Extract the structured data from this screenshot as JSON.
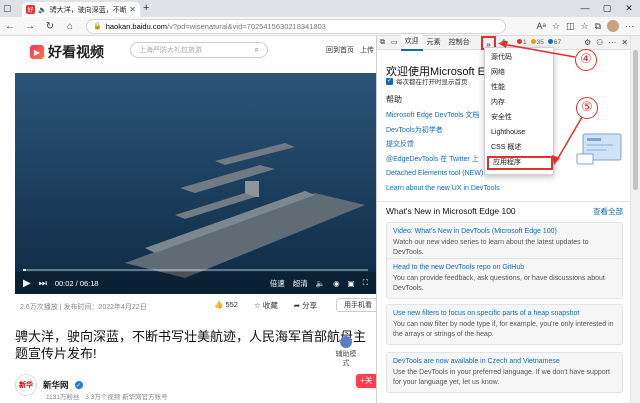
{
  "tab": {
    "title": "骋大洋，驶向深蓝，不断书写壮",
    "favicon_glyph": "好"
  },
  "address": {
    "host": "haokan.baidu.com",
    "path": "/v?pd=wisenatural&vid=7025415630218341803"
  },
  "page": {
    "logo_text": "好看视频",
    "search_placeholder": "上海严防大礼包旅游",
    "back_home": "回到首页",
    "upload": "上传",
    "video_time": "00:02 / 06:18",
    "ctrl_speed": "倍速",
    "ctrl_quality": "超清",
    "progress_fraction": 0.005,
    "meta": "2.6万次播放 | 发布时间：2022年4月22日",
    "like_count": "552",
    "favorite": "收藏",
    "share": "分享",
    "report": "用手机看",
    "headline": "骋大洋，驶向深蓝，不断书写壮美航迹，人民海军首部航母主题宣传片发布!",
    "author_name": "新华网",
    "author_logo": "新华",
    "author_stats": "1131万粉丝 · 3.3万个视频    新华网官方账号",
    "assist": "辅助模式",
    "follow": "+关"
  },
  "devtools": {
    "tabs": [
      "欢迎",
      "元素",
      "控制台"
    ],
    "more": "»",
    "badges": {
      "errors": "1",
      "warnings": "35",
      "info": "67"
    },
    "welcome_title": "欢迎使用Microsoft Edge",
    "open_check": "每次都在打开时显示首页",
    "help_heading": "帮助",
    "help_links": [
      "Microsoft Edge DevTools 文档",
      "DevTools为初学者",
      "提交反馈",
      "@EdgeDevTools 在 Twitter 上",
      "Detached Elements tool (NEW)",
      "Learn about the new UX in DevTools"
    ],
    "whats_new": "What's New in Microsoft Edge 100",
    "view_all": "查看全部",
    "news": [
      {
        "title": "Video: What's New in DevTools (Microsoft Edge 100)",
        "body": "Watch our new video series to learn about the latest updates to DevTools."
      },
      {
        "title": "Head to the new DevTools repo on GitHub",
        "body": "You can provide feedback, ask questions, or have discussions about DevTools."
      },
      {
        "title": "Use new filters to focus on specific parts of a heap snapshot",
        "body": "You can now filter by node type if, for example, you're only interested in the arrays or strings of the heap."
      },
      {
        "title": "DevTools are now available in Czech and Vietnamese",
        "body": "Use the DevTools in your preferred language. If we don't have support for your language yet, let us know."
      }
    ]
  },
  "dropdown": {
    "items": [
      "源代码",
      "网络",
      "性能",
      "内存",
      "安全性",
      "Lighthouse",
      "CSS 概述",
      "应用程序"
    ],
    "highlighted": "应用程序"
  },
  "annotations": {
    "step4": "④",
    "step5": "⑤"
  },
  "colors": {
    "annotation_red": "#e03030",
    "devtools_link": "#0f6cbd"
  }
}
